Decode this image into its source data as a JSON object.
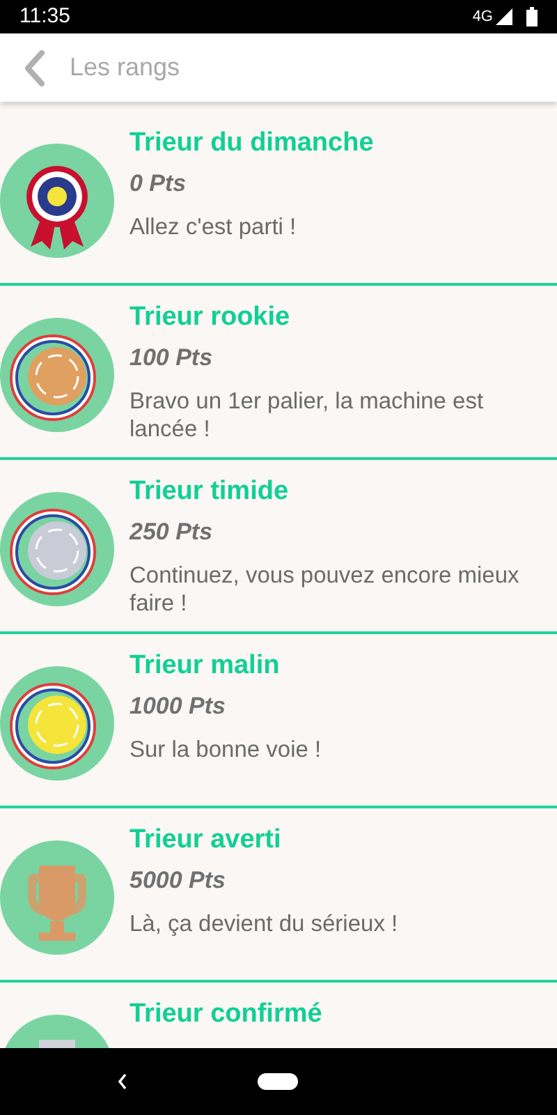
{
  "status_bar": {
    "time": "11:35",
    "network": "4G"
  },
  "header": {
    "title": "Les rangs"
  },
  "ranks": [
    {
      "title": "Trieur du dimanche",
      "points": "0 Pts",
      "description": "Allez c'est parti !",
      "kind": "rosette",
      "color": "#2a3a8c"
    },
    {
      "title": "Trieur rookie",
      "points": "100 Pts",
      "description": "Bravo un 1er palier, la machine est lancée !",
      "kind": "medal",
      "color": "#e0a060"
    },
    {
      "title": "Trieur timide",
      "points": "250 Pts",
      "description": "Continuez, vous pouvez encore mieux faire !",
      "kind": "medal",
      "color": "#c9ccd6"
    },
    {
      "title": "Trieur malin",
      "points": "1000 Pts",
      "description": "Sur la bonne voie !",
      "kind": "medal",
      "color": "#f5e43a"
    },
    {
      "title": "Trieur averti",
      "points": "5000 Pts",
      "description": "Là, ça devient du sérieux !",
      "kind": "trophy",
      "color": "#d99a68"
    },
    {
      "title": "Trieur confirmé",
      "kind": "trophy",
      "color": "#cfd2da"
    }
  ]
}
